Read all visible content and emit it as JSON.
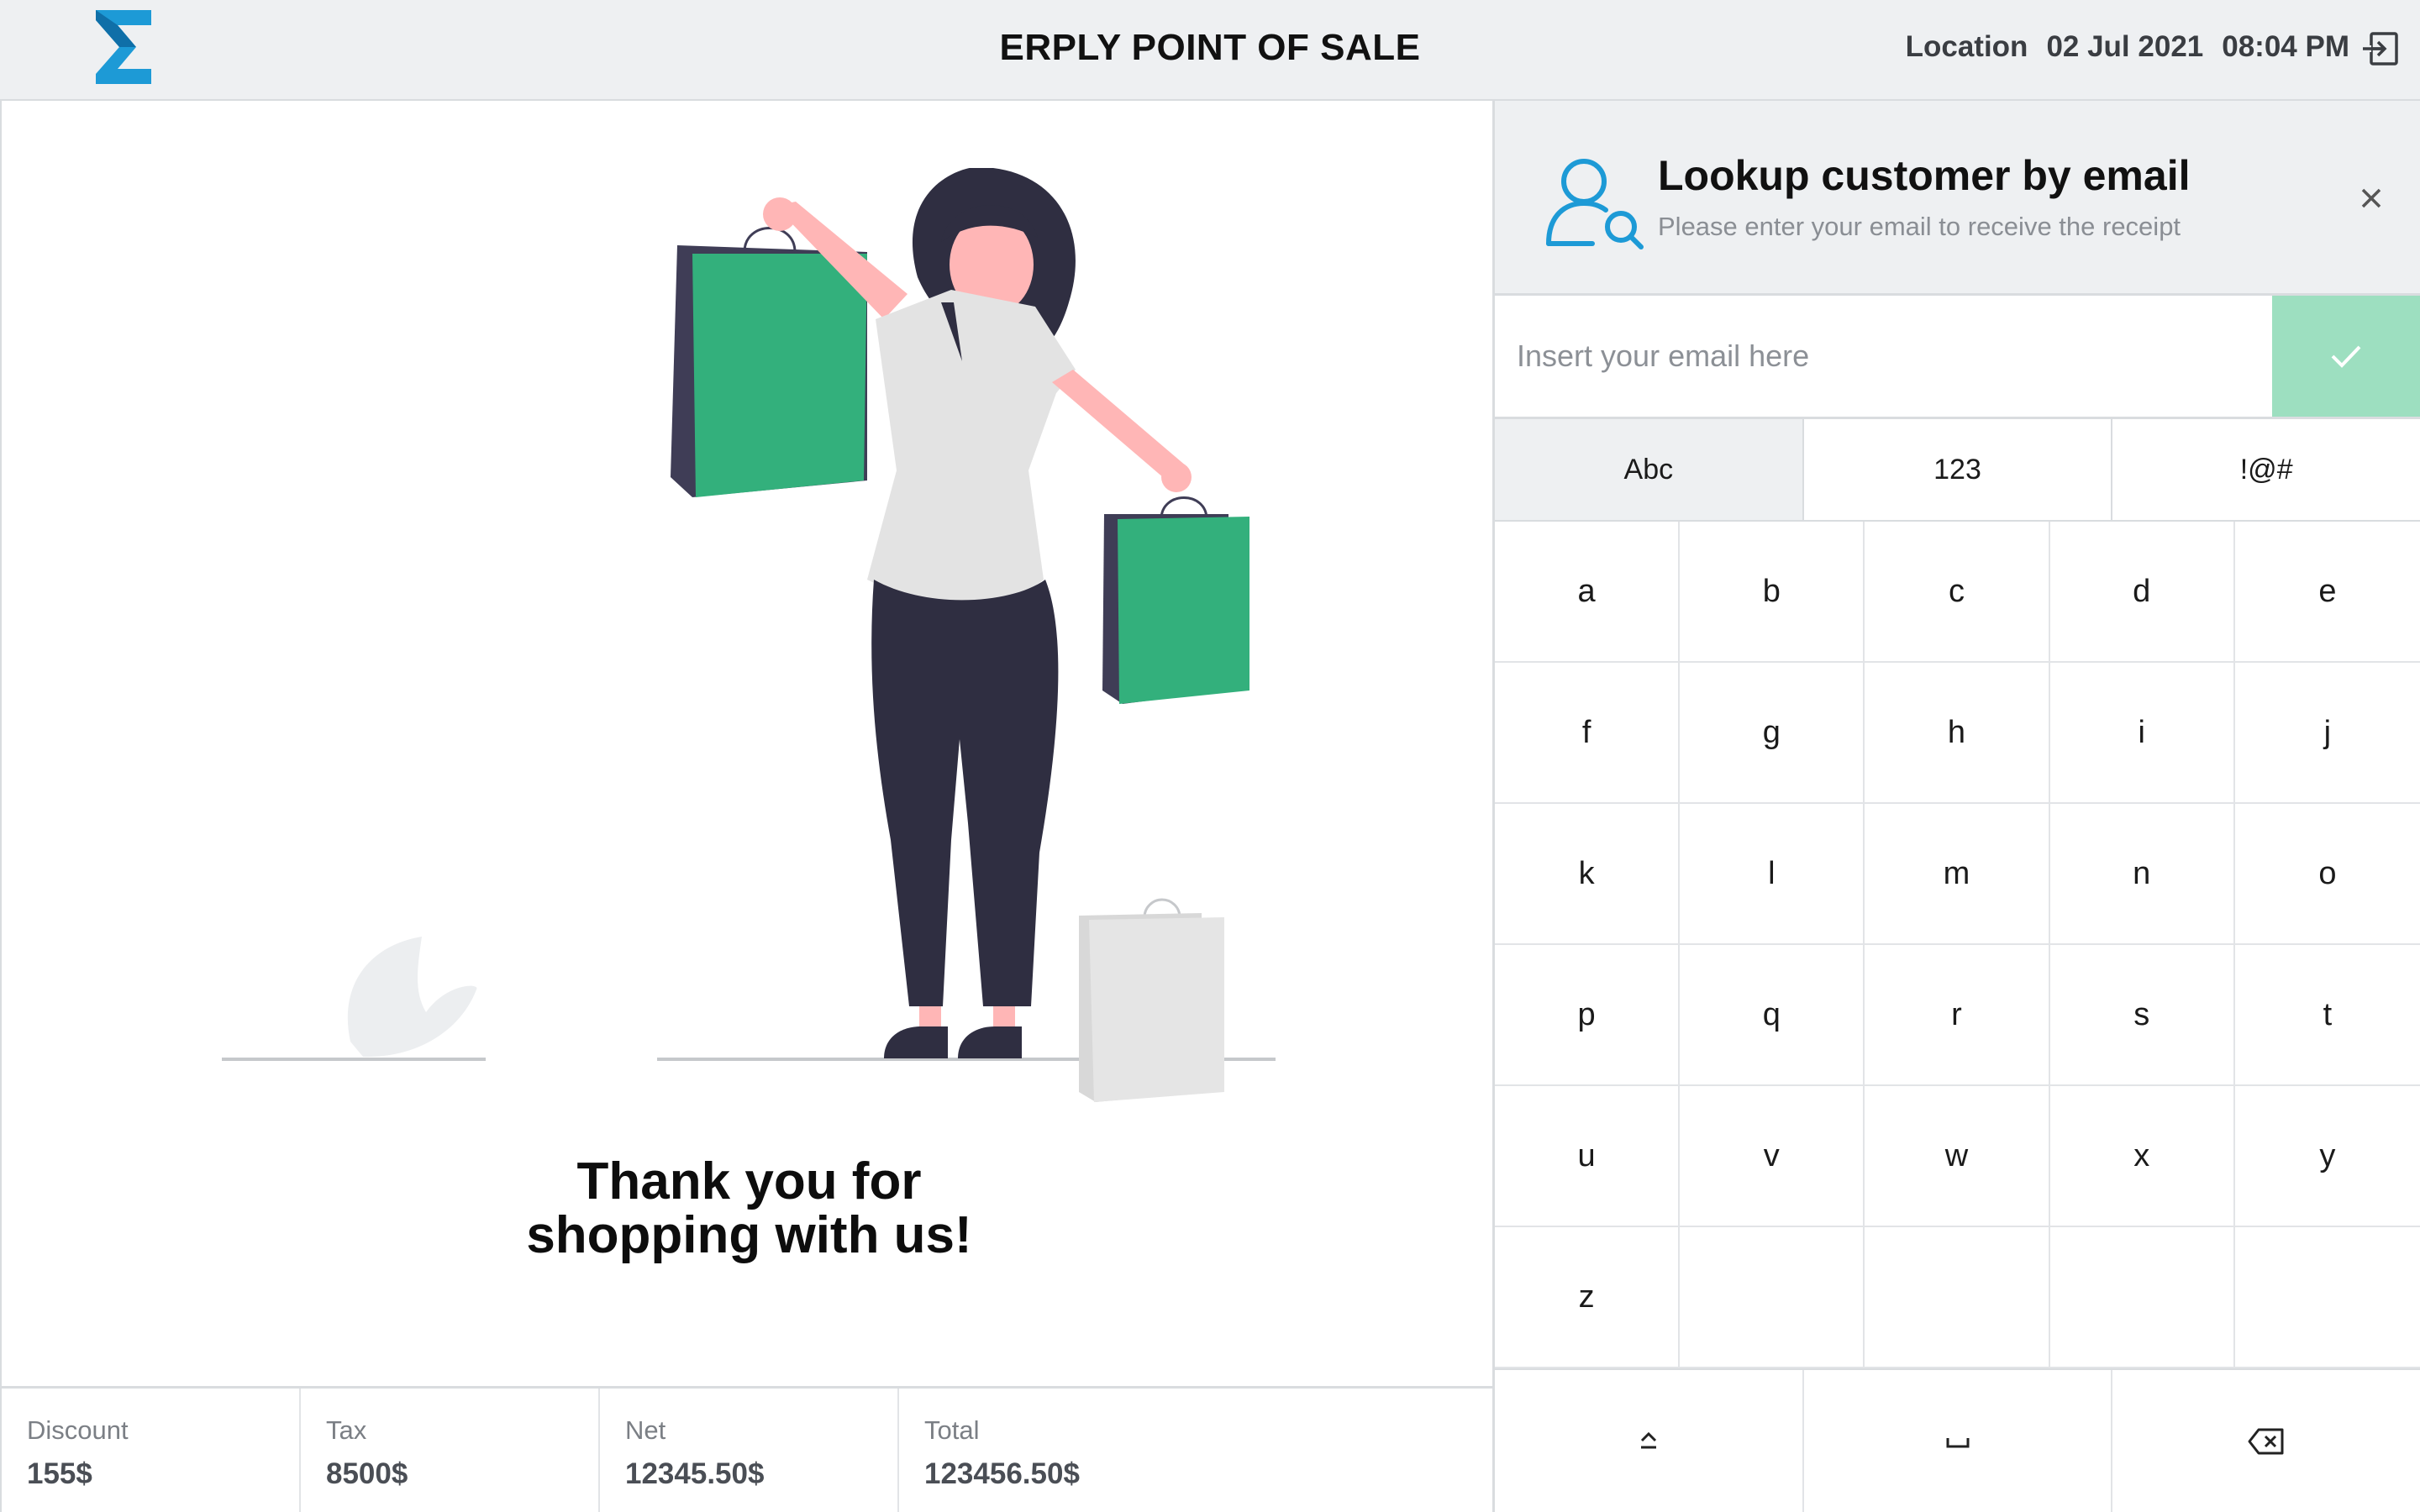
{
  "header": {
    "title": "ERPLY POINT OF SALE",
    "location_label": "Location",
    "date": "02 Jul 2021",
    "time": "08:04 PM",
    "logo_icon": "sigma-logo-icon",
    "logout_icon": "logout-icon"
  },
  "main": {
    "thank_you_line1": "Thank you for",
    "thank_you_line2": "shopping with us!"
  },
  "totals": [
    {
      "label": "Discount",
      "value": "155$"
    },
    {
      "label": "Tax",
      "value": "8500$"
    },
    {
      "label": "Net",
      "value": "12345.50$"
    },
    {
      "label": "Total",
      "value": "123456.50$"
    }
  ],
  "lookup": {
    "title": "Lookup customer by email",
    "subtitle": "Please enter your email to receive the receipt",
    "icon": "user-search-icon",
    "close_icon": "close-icon"
  },
  "email": {
    "placeholder": "Insert your email here",
    "value": "",
    "submit_icon": "check-icon",
    "accent_color": "#9ddfc0"
  },
  "keyboard": {
    "modes": [
      "Abc",
      "123",
      "!@#"
    ],
    "active_mode": "Abc",
    "keys": [
      "a",
      "b",
      "c",
      "d",
      "e",
      "f",
      "g",
      "h",
      "i",
      "j",
      "k",
      "l",
      "m",
      "n",
      "o",
      "p",
      "q",
      "r",
      "s",
      "t",
      "u",
      "v",
      "w",
      "x",
      "y",
      "z"
    ],
    "bottom_icons": [
      "shift-icon",
      "space-icon",
      "backspace-icon"
    ]
  },
  "colors": {
    "brand_blue": "#1d9ad6",
    "bag_green": "#33b07c",
    "header_bg": "#eef0f2"
  }
}
